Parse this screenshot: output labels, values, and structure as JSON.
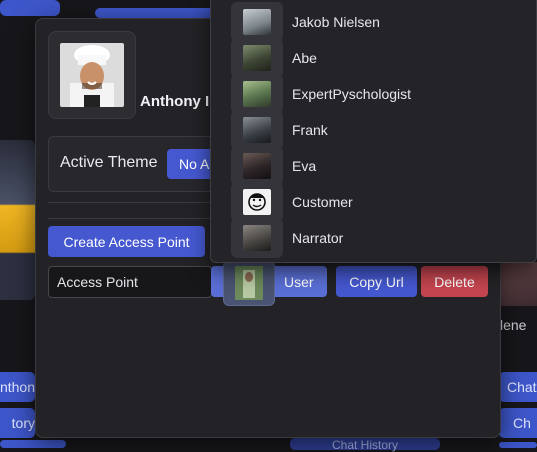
{
  "background": {
    "left_buttons": [
      "nthon",
      "tory"
    ],
    "right_buttons": [
      "Chat",
      "Ch"
    ],
    "bottom_button": "Chat History",
    "right_text": "lene"
  },
  "modal": {
    "profile_name": "Anthony I",
    "theme": {
      "label": "Active Theme",
      "button": "No Ac"
    },
    "create_access_point_label": "Create Access Point",
    "access_point_input_value": "Access Point",
    "user_button_label": "User",
    "copy_url_label": "Copy Url",
    "delete_label": "Delete"
  },
  "dropdown": {
    "items": [
      {
        "label": "Jakob Nielsen",
        "color": "#9aa3a8"
      },
      {
        "label": "Abe",
        "color": "#5f6b52"
      },
      {
        "label": "ExpertPyschologist",
        "color": "#6f8a64"
      },
      {
        "label": "Frank",
        "color": "#4a5056"
      },
      {
        "label": "Eva",
        "color": "#3b3336"
      },
      {
        "label": "Customer",
        "color": "#e9e9e9"
      },
      {
        "label": "Narrator",
        "color": "#4d4a48"
      }
    ]
  },
  "colors": {
    "primary": "#4558cf",
    "danger": "#c4454f",
    "surface": "#232327"
  }
}
